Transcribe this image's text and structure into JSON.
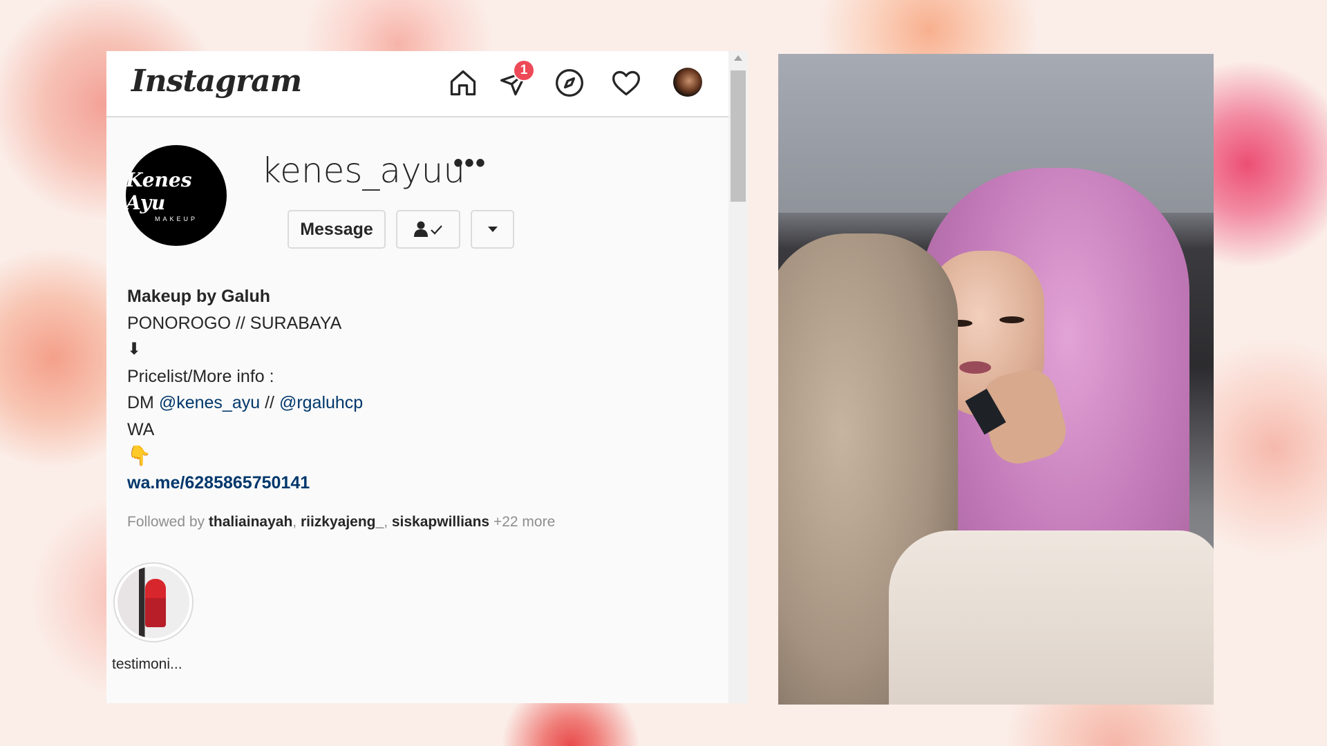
{
  "app": {
    "logo_text": "Instagram"
  },
  "nav": {
    "home_icon": "home-icon",
    "direct_icon": "direct-message-icon",
    "direct_badge": "1",
    "explore_icon": "compass-icon",
    "activity_icon": "heart-icon",
    "profile_icon": "avatar"
  },
  "profile": {
    "avatar_logo_main": "Kenes Ayu",
    "avatar_logo_sub": "MAKEUP",
    "username": "kenes_ayuu",
    "more_label": "•••",
    "message_button": "Message",
    "follow_icon": "person-check-icon",
    "dropdown_icon": "caret-down-icon"
  },
  "bio": {
    "name": "Makeup by Galuh",
    "location": "PONOROGO // SURABAYA",
    "arrow": "⬇",
    "pricelist": "Pricelist/More info :",
    "dm_prefix": "DM ",
    "mention1": "@kenes_ayu",
    "dm_sep": " // ",
    "mention2": "@rgaluhcp",
    "wa": "WA",
    "pointer_emoji": "👇",
    "link": "wa.me/6285865750141"
  },
  "followed_by": {
    "prefix": "Followed by ",
    "user1": "thaliainayah",
    "sep1": ", ",
    "user2": "riizkyajeng_",
    "sep2": ", ",
    "user3": "siskapwillians",
    "more": " +22 more"
  },
  "highlights": [
    {
      "label": "testimoni..."
    }
  ],
  "colors": {
    "accent_link": "#00376b",
    "badge_red": "#ed4956",
    "text_primary": "#262626",
    "text_secondary": "#8e8e8e"
  }
}
